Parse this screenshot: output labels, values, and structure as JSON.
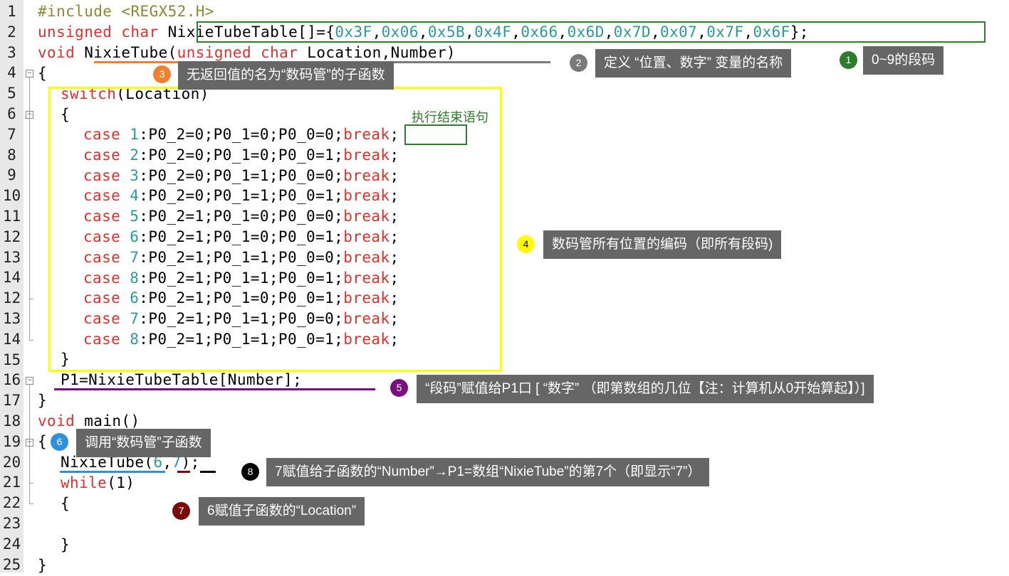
{
  "editor": {
    "line_numbers": [
      "1",
      "2",
      "3",
      "4",
      "5",
      "6",
      "7",
      "8",
      "9",
      "10",
      "11",
      "12",
      "13",
      "14",
      "12",
      "13",
      "14",
      "15",
      "16",
      "17",
      "18",
      "19",
      "20",
      "21",
      "22",
      "23",
      "24",
      "25"
    ]
  },
  "code": {
    "include_directive": "#include",
    "include_header": "<REGX52.H>",
    "line2_type": "unsigned char",
    "array_name": "NixieTubeTable[]={",
    "array_values": [
      "0x3F",
      "0x06",
      "0x5B",
      "0x4F",
      "0x66",
      "0x6D",
      "0x7D",
      "0x07",
      "0x7F",
      "0x6F"
    ],
    "array_close": "};",
    "func_void": "void",
    "func_name": "NixieTube",
    "func_paren_open": "(",
    "param_type": "unsigned char",
    "param_location": "Location,",
    "param_number": "Number)",
    "brace_open_func": "{",
    "switch_kw": "switch",
    "switch_arg": "(Location)",
    "switch_open": "{",
    "case_kw": "case",
    "break_kw": "break",
    "cases": [
      {
        "n": "1",
        "body": ":P0_2=0;P0_1=0;P0_0=0;"
      },
      {
        "n": "2",
        "body": ":P0_2=0;P0_1=0;P0_0=1;"
      },
      {
        "n": "3",
        "body": ":P0_2=0;P0_1=1;P0_0=0;"
      },
      {
        "n": "4",
        "body": ":P0_2=0;P0_1=1;P0_0=1;"
      },
      {
        "n": "5",
        "body": ":P0_2=1;P0_1=0;P0_0=0;"
      },
      {
        "n": "6",
        "body": ":P0_2=1;P0_1=0;P0_0=1;"
      },
      {
        "n": "7",
        "body": ":P0_2=1;P0_1=1;P0_0=0;"
      },
      {
        "n": "8",
        "body": ":P0_2=1;P0_1=1;P0_0=1;"
      },
      {
        "n": "6",
        "body": ":P0_2=1;P0_1=0;P0_0=1;"
      },
      {
        "n": "7",
        "body": ":P0_2=1;P0_1=1;P0_0=0;"
      },
      {
        "n": "8",
        "body": ":P0_2=1;P0_1=1;P0_0=1;"
      }
    ],
    "semicolon": ";",
    "switch_close": "}",
    "p1_assign": "P1=NixieTubeTable[Number];",
    "func_close": "}",
    "main_void": "void",
    "main_name": "main()",
    "main_open": "{",
    "call_name": "NixieTube",
    "call_open": "(",
    "call_arg1": "6",
    "call_comma": ",",
    "call_arg2": "7",
    "call_close": ");",
    "while_kw": "while",
    "while_arg": "(1)",
    "while_open": "{",
    "while_close": "}",
    "main_close": "}"
  },
  "annotations": {
    "a1": {
      "num": "1",
      "text": "0~9的段码",
      "color": "#2e7d2e"
    },
    "a2": {
      "num": "2",
      "text": "定义 “位置、数字” 变量的名称",
      "color": "#7a7a7a"
    },
    "a3": {
      "num": "3",
      "text": "无返回值的名为“数码管”的子函数",
      "color": "#f08030"
    },
    "a4": {
      "num": "4",
      "text": "数码管所有位置的编码（即所有段码)",
      "color": "#ffff00"
    },
    "a5": {
      "num": "5",
      "text": "“段码”赋值给P1口 [ “数字” （即第数组的几位【注：计算机从0开始算起】）]",
      "color": "#7a1080"
    },
    "a6": {
      "num": "6",
      "text": "调用“数码管”子函数",
      "color": "#2f8fe0"
    },
    "a7": {
      "num": "7",
      "text": "6赋值子函数的“Location”",
      "color": "#7a0a0a"
    },
    "a8": {
      "num": "8",
      "text": "7赋值给子函数的“Number”→P1=数组“NixieTube”的第7个（即显示“7”）",
      "color": "#000000"
    },
    "break_label": "执行结束语句"
  },
  "colors": {
    "keyword": "#e0302c",
    "preprocessor": "#8a8a34",
    "number": "#2a9a9a",
    "green_box": "#2e7d2e",
    "yellow_box": "#ffff00",
    "purple_line": "#7a1080",
    "blue_line": "#2f8fe0",
    "orange_line": "#f08030"
  }
}
